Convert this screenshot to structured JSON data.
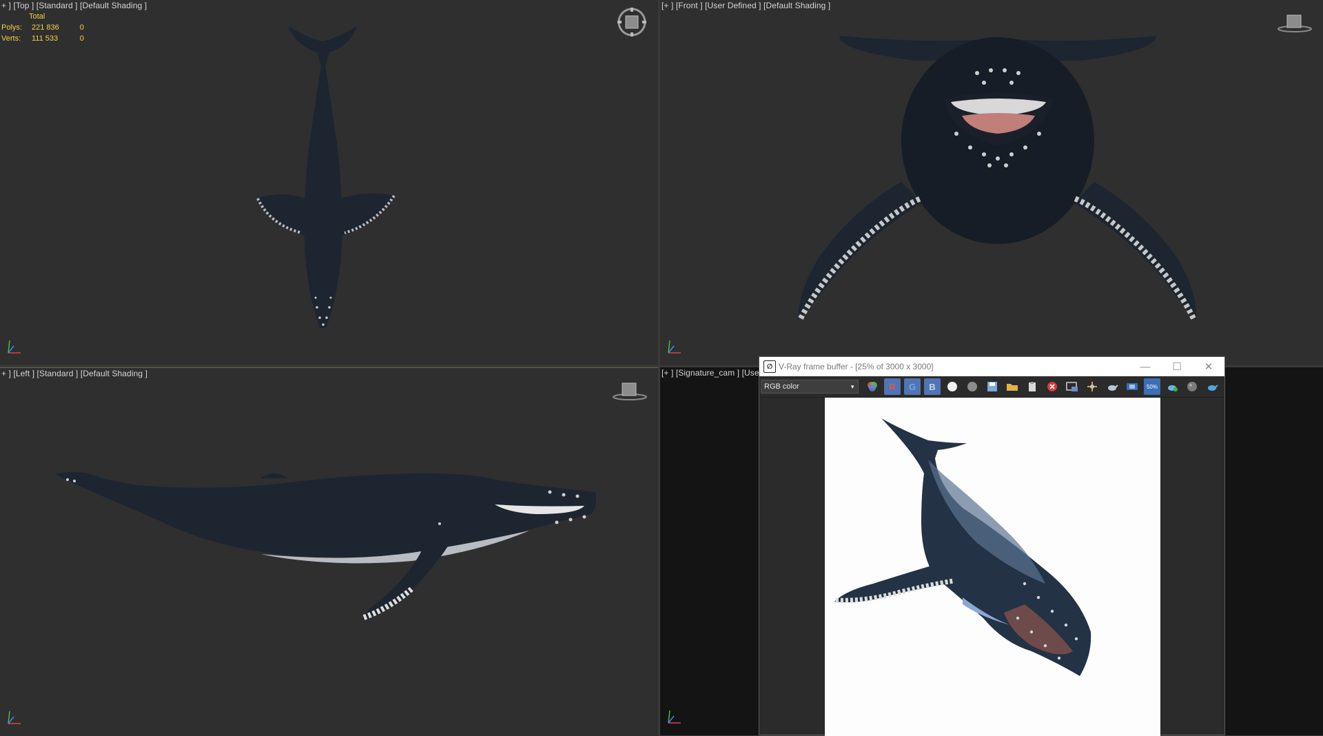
{
  "viewports": {
    "top": {
      "label": "+ ] [Top ] [Standard ] [Default Shading ]",
      "stats": {
        "header": "Total",
        "rows": [
          {
            "label": "Polys:",
            "value": "221 836",
            "sel": "0"
          },
          {
            "label": "Verts:",
            "value": "111 533",
            "sel": "0"
          }
        ]
      }
    },
    "front": {
      "label": "[+ ] [Front ] [User Defined ] [Default Shading ]"
    },
    "left": {
      "label": "+ ] [Left ] [Standard ] [Default Shading ]"
    },
    "camera": {
      "label": "[+ ] [Signature_cam ] [User"
    }
  },
  "vfb": {
    "title": "V-Ray frame buffer - [25% of 3000 x 3000]",
    "channel_select": "RGB color",
    "channel_buttons": [
      "R",
      "G",
      "B"
    ],
    "zoom_badge": "50%",
    "icons": [
      "layers-icon",
      "circle-white-icon",
      "circle-grey-icon",
      "save-icon",
      "open-folder-icon",
      "clipboard-icon",
      "clear-icon",
      "region-icon",
      "link-icon",
      "teapot-icon",
      "compare-icon",
      "zoom-icon",
      "teapot-render-icon",
      "sphere-icon",
      "teapot-blue-icon"
    ]
  },
  "colors": {
    "viewport_bg": "#2f2f2f",
    "stats_text": "#f3d24a",
    "whale_body": "#1c2530",
    "whale_belly": "#c9c9c9",
    "channel_active": "#4f75b5"
  }
}
